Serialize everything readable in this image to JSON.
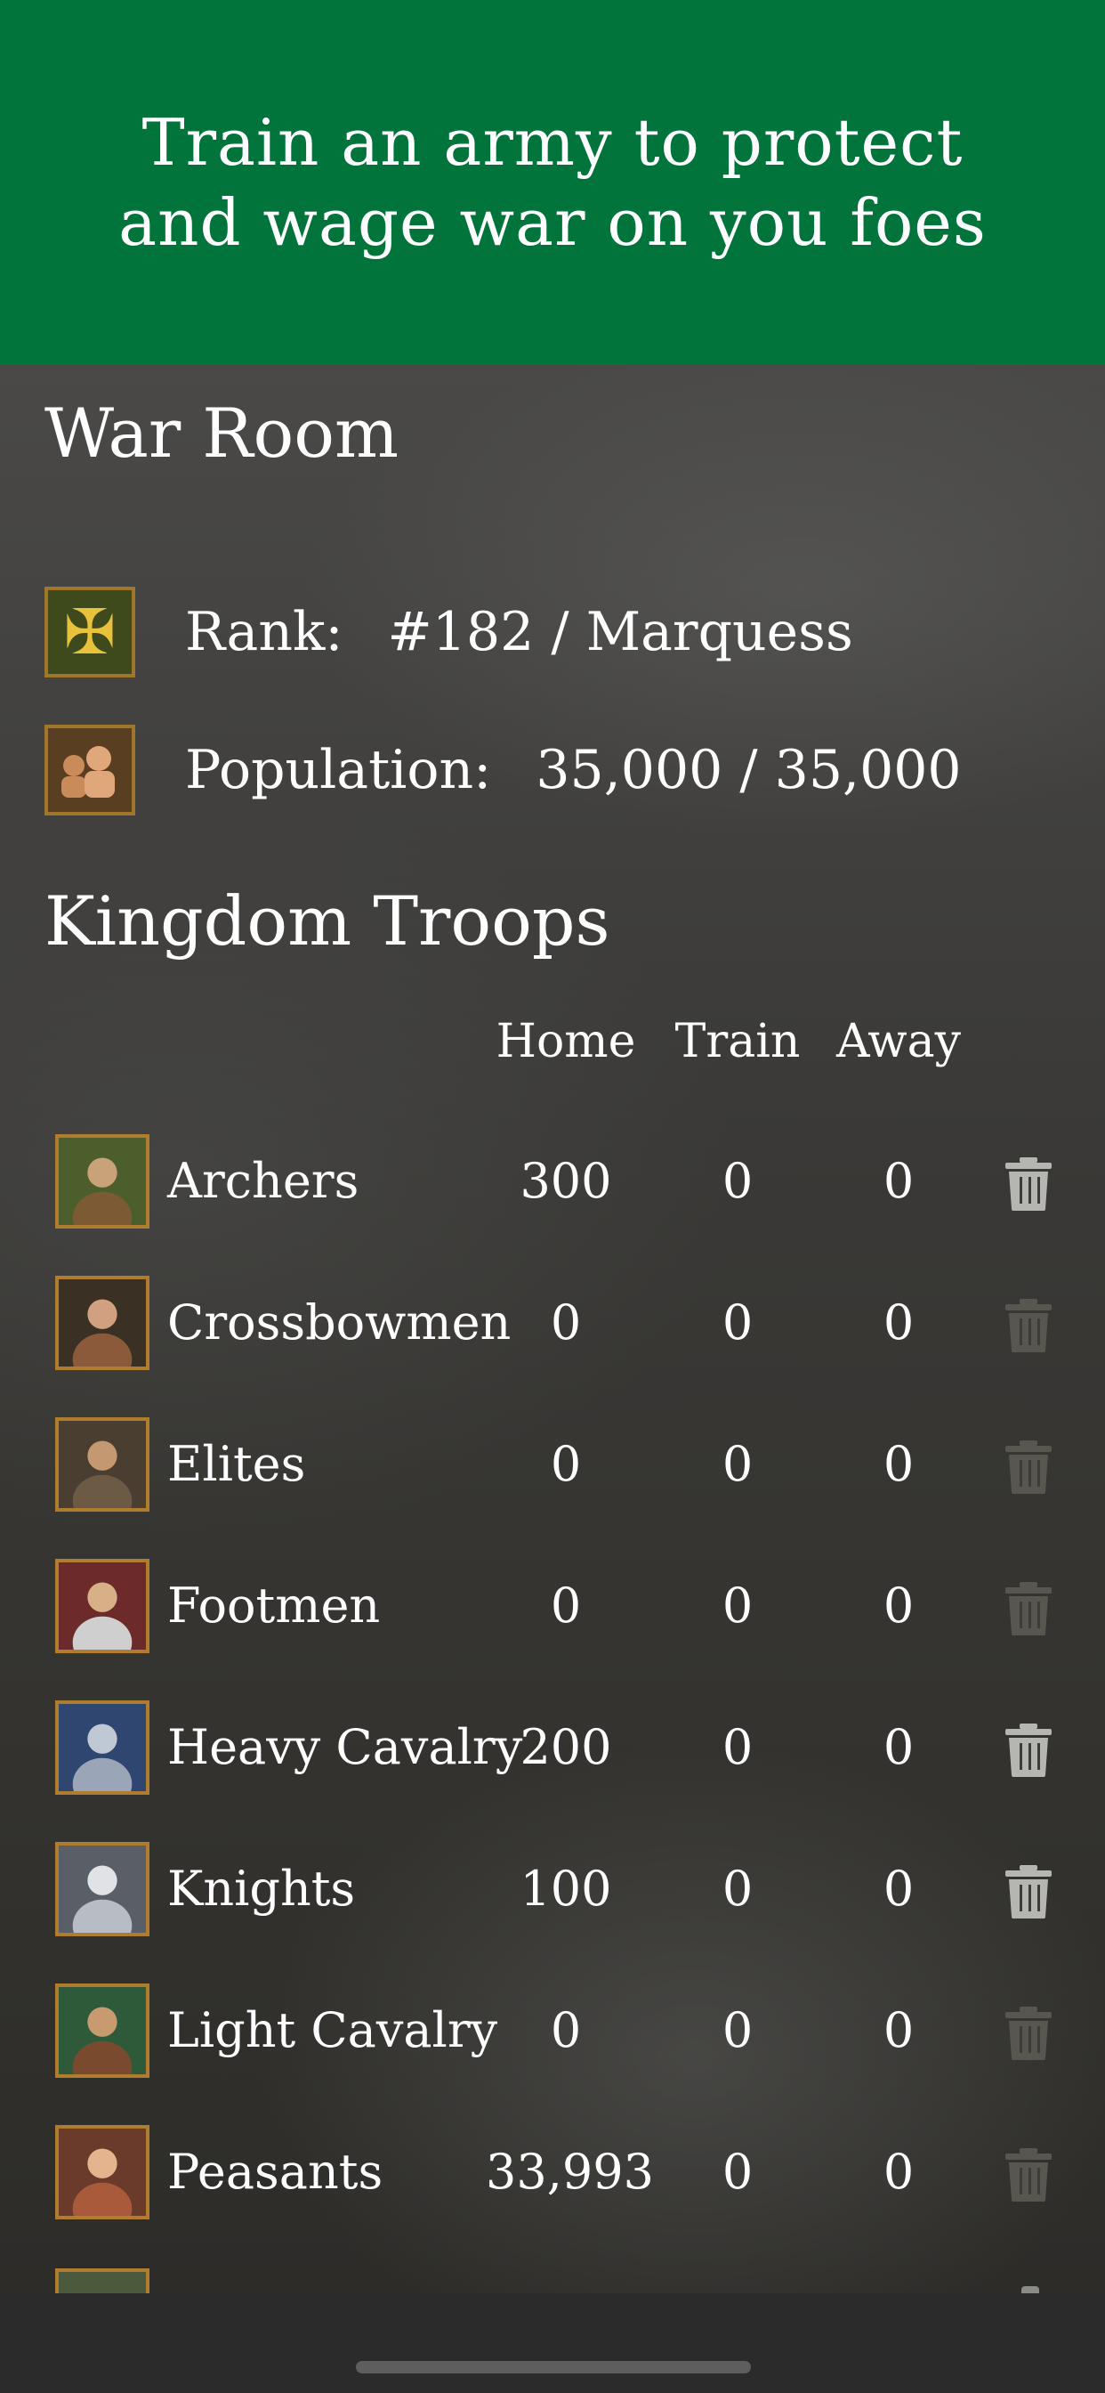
{
  "banner": {
    "line1": "Train an army to protect",
    "line2": "and wage war on you foes"
  },
  "war_room": {
    "title": "War Room",
    "rank_label": "Rank:",
    "rank_value": "#182 / Marquess",
    "rank_icon": "maltese-cross-icon",
    "population_label": "Population:",
    "population_value": "35,000 / 35,000",
    "population_icon": "people-icon"
  },
  "troops": {
    "title": "Kingdom Troops",
    "columns": {
      "home": "Home",
      "train": "Train",
      "away": "Away"
    },
    "rows": [
      {
        "name": "Archers",
        "home": "300",
        "train": "0",
        "away": "0",
        "delete_enabled": true
      },
      {
        "name": "Crossbowmen",
        "home": "0",
        "train": "0",
        "away": "0",
        "delete_enabled": false
      },
      {
        "name": "Elites",
        "home": "0",
        "train": "0",
        "away": "0",
        "delete_enabled": false
      },
      {
        "name": "Footmen",
        "home": "0",
        "train": "0",
        "away": "0",
        "delete_enabled": false
      },
      {
        "name": "Heavy Cavalry",
        "home": "200",
        "train": "0",
        "away": "0",
        "delete_enabled": true
      },
      {
        "name": "Knights",
        "home": "100",
        "train": "0",
        "away": "0",
        "delete_enabled": true
      },
      {
        "name": "Light Cavalry",
        "home": "0",
        "train": "0",
        "away": "0",
        "delete_enabled": false
      },
      {
        "name": "Peasants",
        "home": "33,993",
        "train": "0",
        "away": "0",
        "delete_enabled": false
      }
    ]
  },
  "colors": {
    "banner": "#00743a",
    "thumb_border": "#b07d2e",
    "trash_enabled": "#b5b5b2",
    "trash_disabled": "#58574f"
  }
}
